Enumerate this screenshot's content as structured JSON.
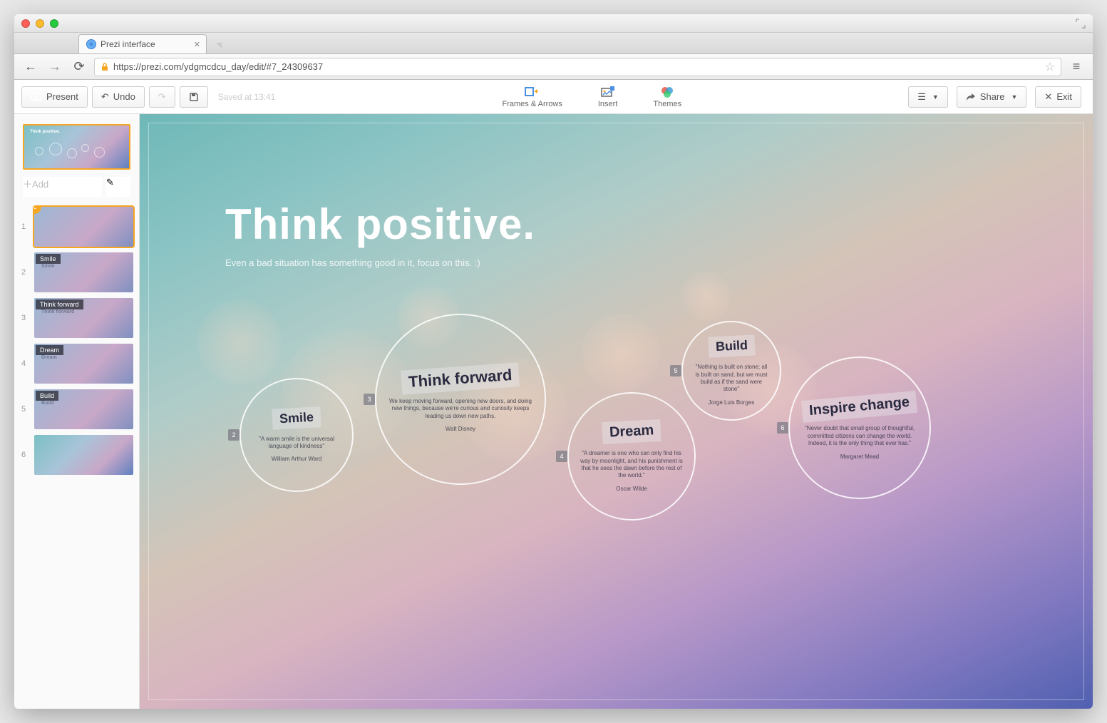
{
  "browser": {
    "tab_title": "Prezi interface",
    "url": "https://prezi.com/ydgmcdcu_day/edit/#7_24309637"
  },
  "toolbar": {
    "present": "Present",
    "undo": "Undo",
    "saved": "Saved at 13:41",
    "frames": "Frames & Arrows",
    "insert": "Insert",
    "themes": "Themes",
    "share": "Share",
    "exit": "Exit"
  },
  "sidebar": {
    "add": "Add",
    "overview_title": "Think positive.",
    "items": [
      {
        "num": "1",
        "label": ""
      },
      {
        "num": "2",
        "label": "Smile"
      },
      {
        "num": "3",
        "label": "Think forward"
      },
      {
        "num": "4",
        "label": "Dream"
      },
      {
        "num": "5",
        "label": "Build"
      },
      {
        "num": "6",
        "label": ""
      }
    ]
  },
  "canvas": {
    "title": "Think positive.",
    "subtitle": "Even a bad situation has something good in it, focus on this.  :)",
    "bubbles": [
      {
        "num": "2",
        "title": "Smile",
        "quote": "\"A warm smile is the universal language of kindness\"",
        "author": "William Arthur Ward"
      },
      {
        "num": "3",
        "title": "Think forward",
        "quote": "We keep moving forward, opening new doors, and doing new things, because we're curious and curiosity keeps leading us down new paths.",
        "author": "Walt Disney"
      },
      {
        "num": "4",
        "title": "Dream",
        "quote": "\"A dreamer is one who can only find his way by moonlight, and his punishment is that he sees the dawn before the rest of the world.\"",
        "author": "Oscar Wilde"
      },
      {
        "num": "5",
        "title": "Build",
        "quote": "\"Nothing is built on stone; all is built on sand, but we must build as if the sand were stone\"",
        "author": "Jorge Luis Borges"
      },
      {
        "num": "6",
        "title": "Inspire change",
        "quote": "\"Never doubt that small group of thoughtful, committed citizens can change the world. Indeed, it is the only thing that ever has.\"",
        "author": "Margaret Mead"
      }
    ]
  }
}
